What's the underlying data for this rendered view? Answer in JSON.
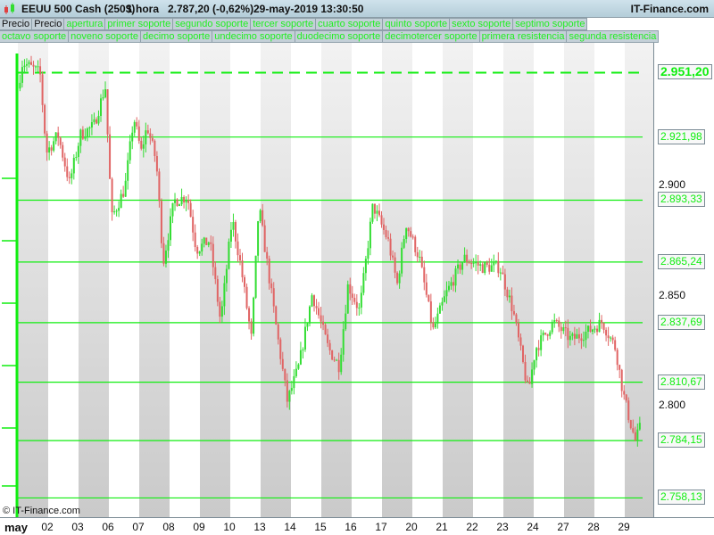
{
  "header": {
    "instrument": "EEUU 500 Cash (250$)",
    "timeframe": "1 hora",
    "price": "2.787,20 (-0,62%)",
    "datetime": "29-may-2019 13:30:50",
    "brand": "IT-Finance.com"
  },
  "legend_row1": [
    "Precio",
    "Precio",
    "apertura",
    "primer soporte",
    "segundo soporte",
    "tercer soporte",
    "cuarto soporte",
    "quinto soporte",
    "sexto soporte",
    "septimo soporte"
  ],
  "legend_row2": [
    "octavo soporte",
    "noveno soporte",
    "decimo soporte",
    "undecimo soporte",
    "duodecimo soporte",
    "decimotercer soporte",
    "primera resistencia",
    "segunda resistencia"
  ],
  "copyright": "© IT-Finance.com",
  "colors": {
    "up": "#33dd33",
    "down": "#e06464",
    "level": "#11ee11"
  },
  "chart_data": {
    "type": "candlestick",
    "ylim": [
      2748,
      2970
    ],
    "y_ticks": [
      {
        "v": 2900,
        "label": "2.900"
      },
      {
        "v": 2850,
        "label": "2.850"
      },
      {
        "v": 2800,
        "label": "2.800"
      }
    ],
    "levels": [
      {
        "v": 2951.2,
        "label": "2.951,20",
        "style": "dashed",
        "bold": true
      },
      {
        "v": 2921.98,
        "label": "2.921,98"
      },
      {
        "v": 2893.33,
        "label": "2.893,33"
      },
      {
        "v": 2865.24,
        "label": "2.865,24"
      },
      {
        "v": 2837.69,
        "label": "2.837,69"
      },
      {
        "v": 2810.67,
        "label": "2.810,67"
      },
      {
        "v": 2784.15,
        "label": "2.784,15"
      },
      {
        "v": 2758.13,
        "label": "2.758,13"
      }
    ],
    "x_labels": [
      "may",
      "02",
      "03",
      "06",
      "07",
      "08",
      "09",
      "10",
      "13",
      "14",
      "15",
      "16",
      "17",
      "20",
      "21",
      "22",
      "23",
      "24",
      "27",
      "28",
      "29"
    ],
    "price_path": [
      [
        0.06,
        2944
      ],
      [
        0.21,
        2956
      ],
      [
        0.79,
        2951
      ],
      [
        1.0,
        2915
      ],
      [
        1.38,
        2923
      ],
      [
        1.76,
        2901
      ],
      [
        2.12,
        2923
      ],
      [
        2.56,
        2927
      ],
      [
        2.94,
        2945
      ],
      [
        3.15,
        2885
      ],
      [
        3.59,
        2899
      ],
      [
        3.88,
        2931
      ],
      [
        4.12,
        2915
      ],
      [
        4.32,
        2927
      ],
      [
        4.62,
        2911
      ],
      [
        4.85,
        2865
      ],
      [
        5.21,
        2893
      ],
      [
        5.65,
        2895
      ],
      [
        5.94,
        2871
      ],
      [
        6.38,
        2875
      ],
      [
        6.74,
        2838
      ],
      [
        7.12,
        2885
      ],
      [
        7.41,
        2863
      ],
      [
        7.76,
        2830
      ],
      [
        8.0,
        2891
      ],
      [
        8.29,
        2863
      ],
      [
        8.59,
        2834
      ],
      [
        8.94,
        2802
      ],
      [
        9.32,
        2818
      ],
      [
        9.76,
        2851
      ],
      [
        10.29,
        2826
      ],
      [
        10.65,
        2818
      ],
      [
        10.94,
        2855
      ],
      [
        11.32,
        2843
      ],
      [
        11.76,
        2891
      ],
      [
        12.26,
        2875
      ],
      [
        12.56,
        2855
      ],
      [
        12.85,
        2883
      ],
      [
        13.29,
        2867
      ],
      [
        13.74,
        2834
      ],
      [
        14.18,
        2851
      ],
      [
        14.76,
        2867
      ],
      [
        15.35,
        2863
      ],
      [
        15.94,
        2863
      ],
      [
        16.38,
        2843
      ],
      [
        16.88,
        2806
      ],
      [
        17.12,
        2826
      ],
      [
        17.71,
        2838
      ],
      [
        18.29,
        2830
      ],
      [
        18.88,
        2834
      ],
      [
        19.32,
        2838
      ],
      [
        19.76,
        2826
      ],
      [
        20.0,
        2806
      ],
      [
        20.21,
        2794
      ],
      [
        20.41,
        2784
      ],
      [
        20.59,
        2791
      ]
    ]
  }
}
